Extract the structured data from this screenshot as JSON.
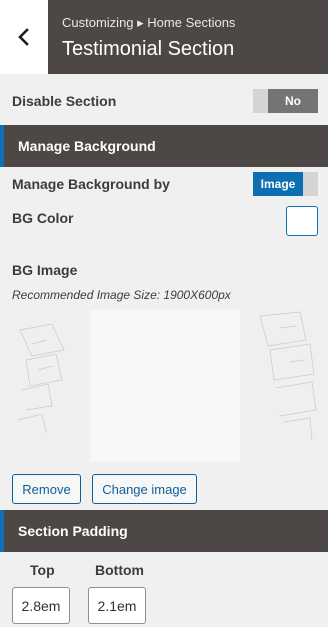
{
  "header": {
    "breadcrumb": "Customizing ▸ Home Sections",
    "title": "Testimonial Section",
    "back_icon": "chevron-left-icon"
  },
  "disable_section": {
    "label": "Disable Section",
    "value": "No"
  },
  "manage_background": {
    "heading": "Manage Background",
    "by_label": "Manage Background by",
    "by_value": "Image",
    "bg_color_label": "BG Color",
    "bg_color_value": "#ffffff",
    "bg_image_label": "BG Image",
    "hint": "Recommended Image Size: 1900X600px",
    "remove_label": "Remove",
    "change_label": "Change image"
  },
  "section_padding": {
    "heading": "Section Padding",
    "top_label": "Top",
    "top_value": "2.8em",
    "bottom_label": "Bottom",
    "bottom_value": "2.1em"
  },
  "colors": {
    "header_bg": "#4d4845",
    "accent": "#0f72b9",
    "toggle_on": "#0d6eb2",
    "toggle_off": "#747474"
  }
}
